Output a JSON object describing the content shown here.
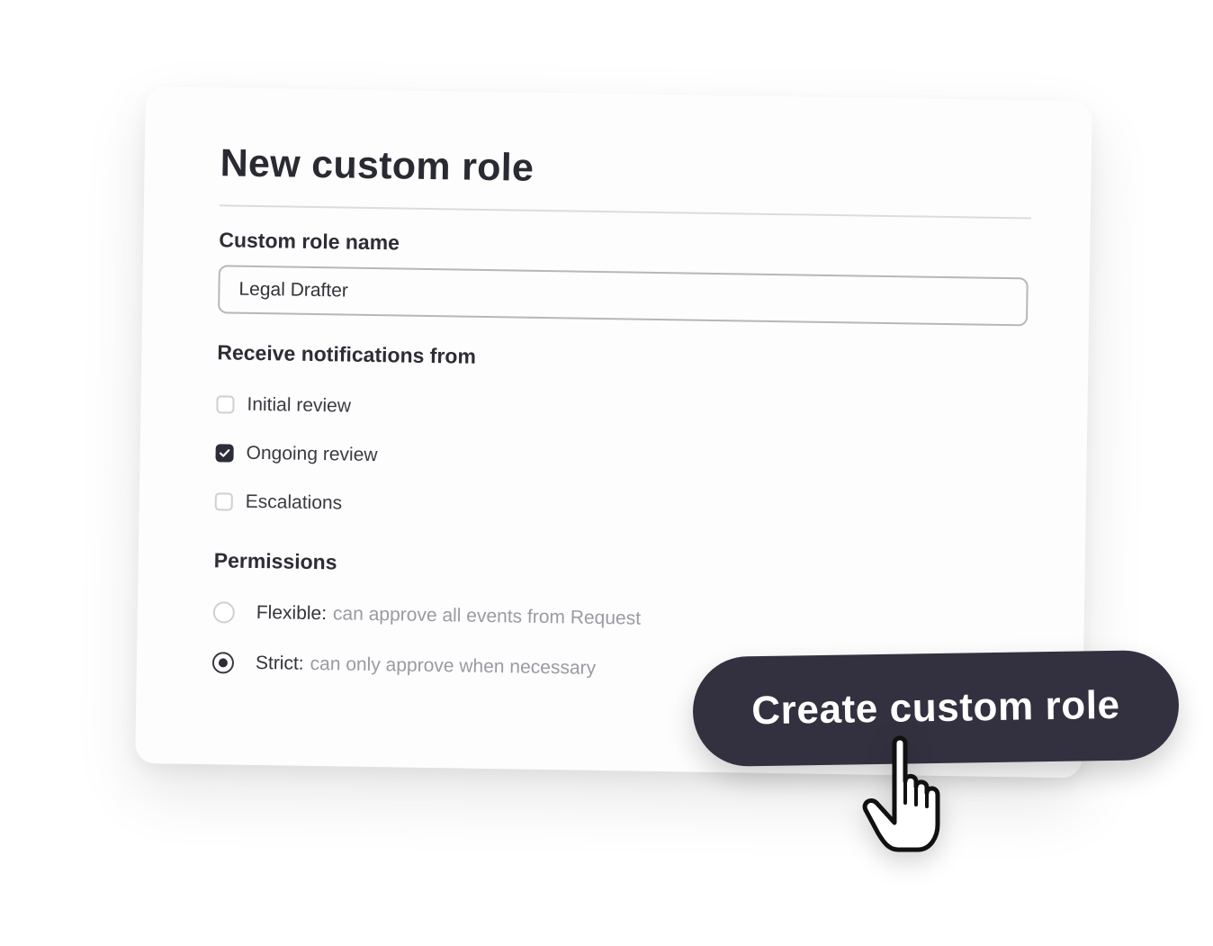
{
  "dialog": {
    "title": "New custom role"
  },
  "role_name": {
    "label": "Custom role name",
    "value": "Legal Drafter"
  },
  "notifications": {
    "label": "Receive notifications from",
    "options": [
      {
        "label": "Initial review",
        "checked": false
      },
      {
        "label": "Ongoing review",
        "checked": true
      },
      {
        "label": "Escalations",
        "checked": false
      }
    ]
  },
  "permissions": {
    "label": "Permissions",
    "options": [
      {
        "name": "Flexible:",
        "description": "can approve all events from Request",
        "selected": false
      },
      {
        "name": "Strict:",
        "description": "can only approve when necessary",
        "selected": true
      }
    ]
  },
  "actions": {
    "create_label": "Create custom role"
  },
  "icons": {
    "checkmark": "checkmark-icon",
    "cursor": "hand-pointer-icon"
  },
  "colors": {
    "accent_dark": "#33313f",
    "text": "#2d2d35",
    "muted": "#9a9aa2"
  }
}
